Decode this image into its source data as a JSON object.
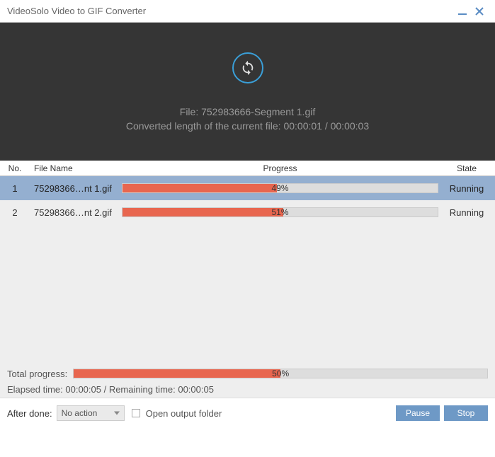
{
  "titlebar": {
    "title": "VideoSolo Video to GIF Converter"
  },
  "preview": {
    "file_label": "File: 752983666-Segment 1.gif",
    "length_label": "Converted length of the current file: 00:00:01 / 00:00:03"
  },
  "table": {
    "headers": {
      "no": "No.",
      "name": "File Name",
      "progress": "Progress",
      "state": "State"
    },
    "rows": [
      {
        "no": "1",
        "name": "75298366…nt 1.gif",
        "progress": 49,
        "progress_label": "49%",
        "state": "Running",
        "selected": true
      },
      {
        "no": "2",
        "name": "75298366…nt 2.gif",
        "progress": 51,
        "progress_label": "51%",
        "state": "Running",
        "selected": false
      }
    ]
  },
  "total": {
    "label": "Total progress:",
    "percent": 50,
    "percent_label": "50%",
    "elapsed": "Elapsed time: 00:00:05 / Remaining time: 00:00:05"
  },
  "footer": {
    "after_done_label": "After done:",
    "after_done_value": "No action",
    "open_output_label": "Open output folder",
    "pause": "Pause",
    "stop": "Stop"
  }
}
